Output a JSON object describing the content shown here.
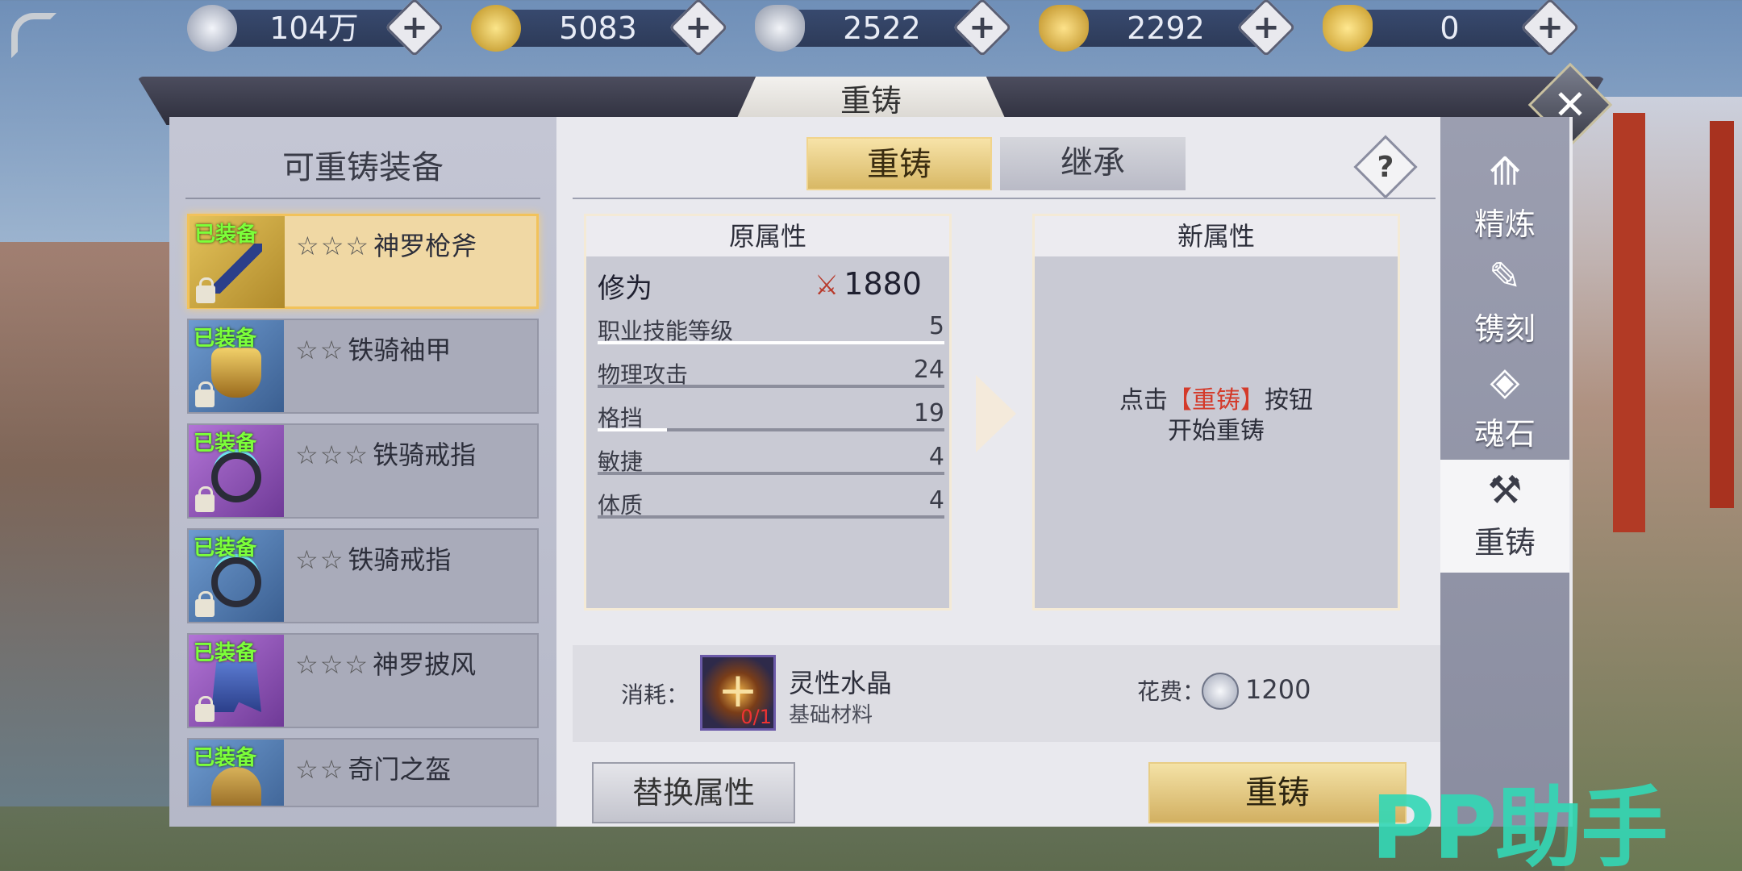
{
  "resources": [
    {
      "icon": "silver-coin-icon",
      "value": "104万",
      "color": "#c9cfdc"
    },
    {
      "icon": "gold-coin-icon",
      "value": "5083",
      "color": "#e3c04a"
    },
    {
      "icon": "silver-ingot-icon",
      "value": "2522",
      "color": "#c7ccd6"
    },
    {
      "icon": "locked-gold-ingot-icon",
      "value": "2292",
      "color": "#e8c34c"
    },
    {
      "icon": "gold-ingot-icon",
      "value": "0",
      "color": "#f0c84a"
    }
  ],
  "panel": {
    "title": "重铸",
    "close": "✕"
  },
  "left": {
    "title": "可重铸装备",
    "items": [
      {
        "tag": "已装备",
        "stars": "☆☆☆",
        "name": "神罗枪斧",
        "bg": "gold",
        "icon": "poleaxe-icon"
      },
      {
        "tag": "已装备",
        "stars": "☆☆",
        "name": "铁骑袖甲",
        "bg": "blue",
        "icon": "bracer-icon"
      },
      {
        "tag": "已装备",
        "stars": "☆☆☆",
        "name": "铁骑戒指",
        "bg": "purple",
        "icon": "ring-icon"
      },
      {
        "tag": "已装备",
        "stars": "☆☆",
        "name": "铁骑戒指",
        "bg": "blue",
        "icon": "ring-icon"
      },
      {
        "tag": "已装备",
        "stars": "☆☆☆",
        "name": "神罗披风",
        "bg": "purple",
        "icon": "cape-icon"
      },
      {
        "tag": "已装备",
        "stars": "☆☆",
        "name": "奇门之盔",
        "bg": "blue",
        "icon": "helmet-icon"
      }
    ]
  },
  "tabs": {
    "recast": "重铸",
    "inherit": "继承",
    "help": "?"
  },
  "old_attrs": {
    "title": "原属性",
    "cultivation_label": "修为",
    "power": "1880",
    "stats": [
      {
        "name": "职业技能等级",
        "value": "5",
        "fill": 1.0
      },
      {
        "name": "物理攻击",
        "value": "24",
        "fill": 0.0
      },
      {
        "name": "格挡",
        "value": "19",
        "fill": 0.2
      },
      {
        "name": "敏捷",
        "value": "4",
        "fill": 0.0
      },
      {
        "name": "体质",
        "value": "4",
        "fill": 0.0
      }
    ]
  },
  "new_attrs": {
    "title": "新属性",
    "hint_prefix": "点击",
    "hint_highlight": "【重铸】",
    "hint_suffix": "按钮",
    "hint_line2": "开始重铸"
  },
  "cost": {
    "label": "消耗：",
    "material_name": "灵性水晶",
    "material_type": "基础材料",
    "material_count": "0/1",
    "fee_label": "花费：",
    "fee_value": "1200"
  },
  "buttons": {
    "replace": "替换属性",
    "recast": "重铸"
  },
  "side_menu": [
    {
      "label": "精炼",
      "icon": "refine-icon",
      "glyph": "⟰"
    },
    {
      "label": "镌刻",
      "icon": "engrave-icon",
      "glyph": "✎"
    },
    {
      "label": "魂石",
      "icon": "soulstone-icon",
      "glyph": "◈"
    },
    {
      "label": "重铸",
      "icon": "recast-icon",
      "glyph": "⚒"
    }
  ],
  "watermark": "PP助手"
}
